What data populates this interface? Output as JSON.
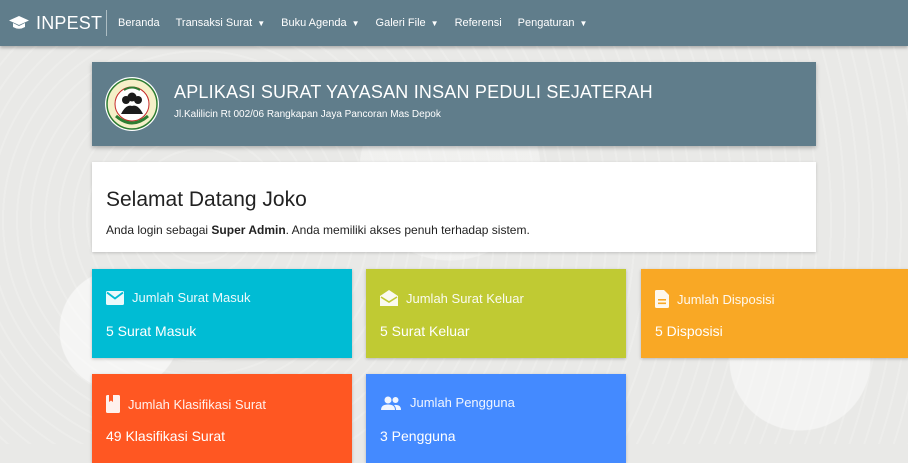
{
  "navbar": {
    "brand": "INPEST",
    "items": [
      {
        "label": "Beranda",
        "dropdown": false
      },
      {
        "label": "Transaksi Surat",
        "dropdown": true
      },
      {
        "label": "Buku Agenda",
        "dropdown": true
      },
      {
        "label": "Galeri File",
        "dropdown": true
      },
      {
        "label": "Referensi",
        "dropdown": false
      },
      {
        "label": "Pengaturan",
        "dropdown": true
      }
    ]
  },
  "header": {
    "title": "APLIKASI SURAT YAYASAN INSAN PEDULI SEJATERAH",
    "address": "Jl.Kalilicin Rt 002/06 Rangkapan Jaya Pancoran Mas Depok"
  },
  "welcome": {
    "heading": "Selamat Datang Joko",
    "text_before": "Anda login sebagai ",
    "role": "Super Admin",
    "text_after": ". Anda memiliki akses penuh terhadap sistem."
  },
  "cards": [
    {
      "title": "Jumlah Surat Masuk",
      "value": "5 Surat Masuk",
      "color": "#00bcd4",
      "icon": "mail-icon"
    },
    {
      "title": "Jumlah Surat Keluar",
      "value": "5 Surat Keluar",
      "color": "#c0ca33",
      "icon": "open-mail-icon"
    },
    {
      "title": "Jumlah Disposisi",
      "value": "5 Disposisi",
      "color": "#f9a825",
      "icon": "document-icon"
    },
    {
      "title": "Jumlah Klasifikasi Surat",
      "value": "49 Klasifikasi Surat",
      "color": "#ff5722",
      "icon": "bookmark-icon"
    },
    {
      "title": "Jumlah Pengguna",
      "value": "3 Pengguna",
      "color": "#448aff",
      "icon": "people-icon"
    }
  ],
  "colors": {
    "navbar": "#607d8b",
    "header": "#607d8b"
  }
}
